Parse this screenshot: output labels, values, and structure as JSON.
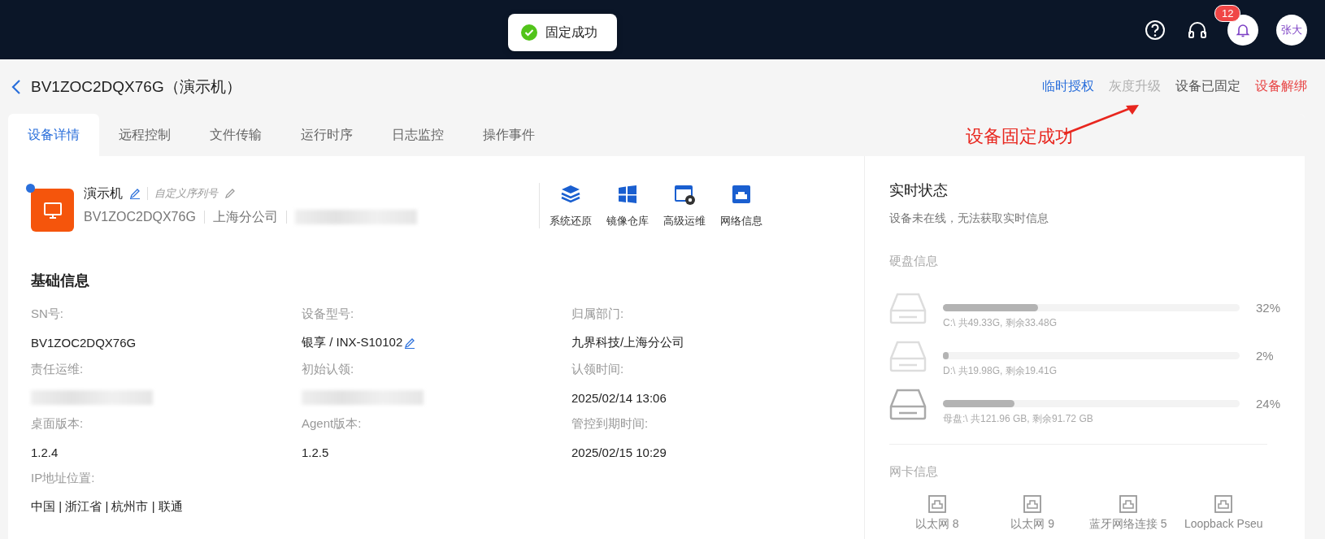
{
  "toast": {
    "kind": "success",
    "text": "固定成功"
  },
  "topbar": {
    "notification_count": "12",
    "avatar": "张大"
  },
  "header": {
    "title": "BV1ZOC2DQX76G（演示机）",
    "actions": [
      {
        "label": "临时授权",
        "kind": "link"
      },
      {
        "label": "灰度升级",
        "kind": "disabled"
      },
      {
        "label": "设备已固定",
        "kind": "plain"
      },
      {
        "label": "设备解绑",
        "kind": "danger"
      }
    ],
    "annotation": "设备固定成功"
  },
  "tabs": [
    {
      "label": "设备详情",
      "selected": true
    },
    {
      "label": "远程控制",
      "selected": false
    },
    {
      "label": "文件传输",
      "selected": false
    },
    {
      "label": "运行时序",
      "selected": false
    },
    {
      "label": "日志监控",
      "selected": false
    },
    {
      "label": "操作事件",
      "selected": false
    }
  ],
  "device": {
    "name": "演示机",
    "custom_serial": "自定义序列号",
    "online": true,
    "meta": [
      {
        "kind": "text",
        "text": "BV1ZOC2DQX76G"
      },
      {
        "kind": "text",
        "text": "上海分公司"
      },
      {
        "kind": "redacted"
      }
    ],
    "tools": [
      {
        "kind": "layers",
        "label": "系统还原"
      },
      {
        "kind": "windows",
        "label": "镜像仓库"
      },
      {
        "kind": "gear-window",
        "label": "高级运维"
      },
      {
        "kind": "network",
        "label": "网络信息"
      }
    ]
  },
  "basic_info": {
    "title": "基础信息",
    "fields": [
      {
        "label": "SN号:",
        "value": "BV1ZOC2DQX76G"
      },
      {
        "label": "设备型号:",
        "value": "银享  / INX-S10102",
        "editable": true
      },
      {
        "label": "归属部门:",
        "value": "九界科技/上海分公司"
      },
      {
        "label": "责任运维:",
        "redacted": true
      },
      {
        "label": "初始认领:",
        "redacted": true
      },
      {
        "label": "认领时间:",
        "value": "2025/02/14 13:06"
      },
      {
        "label": "桌面版本:",
        "value": "1.2.4"
      },
      {
        "label": "Agent版本:",
        "value": "1.2.5"
      },
      {
        "label": "管控到期时间:",
        "value": "2025/02/15 10:29"
      },
      {
        "label": "IP地址位置:",
        "value": "中国 | 浙江省 | 杭州市 | 联通"
      }
    ]
  },
  "realtime": {
    "title": "实时状态",
    "subtitle": "设备未在线，无法获取实时信息",
    "disk_title": "硬盘信息",
    "disks": [
      {
        "level": 0.32,
        "percent": "32%",
        "detail": "C:\\ 共49.33G, 剩余33.48G",
        "highlighted": false
      },
      {
        "level": 0.02,
        "percent": "2%",
        "detail": "D:\\ 共19.98G, 剩余19.41G",
        "highlighted": false
      },
      {
        "level": 0.24,
        "percent": "24%",
        "detail": "母盘:\\ 共121.96 GB, 剩余91.72 GB",
        "highlighted": true
      }
    ],
    "nic_title": "网卡信息",
    "nics": [
      {
        "name": "以太网 8"
      },
      {
        "name": "以太网 9"
      },
      {
        "name": "蓝牙网络连接 5"
      },
      {
        "name": "Loopback Pseu"
      }
    ]
  }
}
